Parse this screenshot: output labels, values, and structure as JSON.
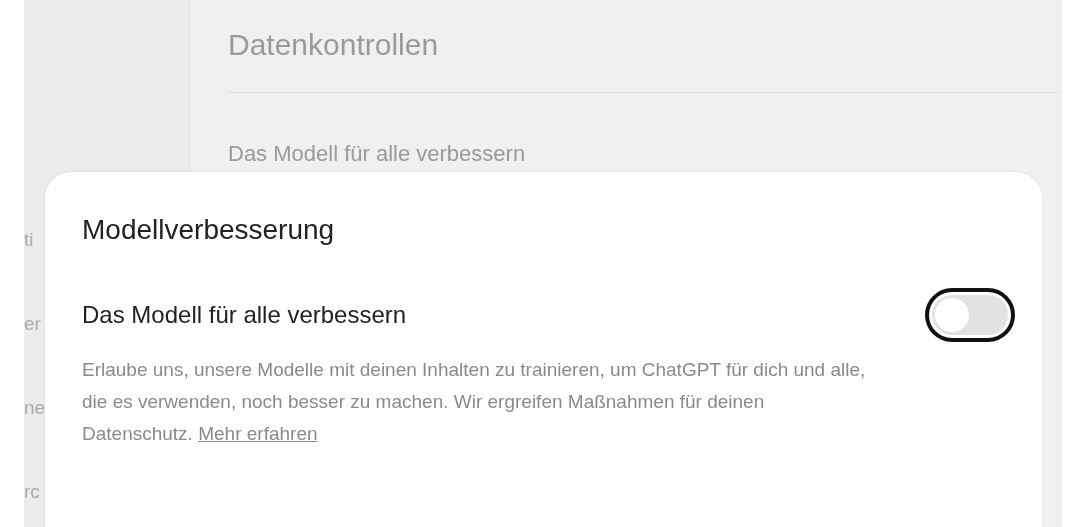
{
  "sidebar": {
    "items": [
      {
        "label": "ti"
      },
      {
        "label": "er"
      },
      {
        "label": "ne"
      },
      {
        "label": "rc"
      }
    ]
  },
  "page": {
    "title": "Datenkontrollen",
    "setting_label": "Das Modell für alle verbessern"
  },
  "dialog": {
    "title": "Modellverbesserung",
    "setting": {
      "label": "Das Modell für alle verbessern",
      "on": false
    },
    "description": "Erlaube uns, unsere Modelle mit deinen Inhalten zu trainieren, um ChatGPT für dich und alle, die es verwenden, noch besser zu machen. Wir ergreifen Maßnahmen für deinen Datenschutz.",
    "link": "Mehr erfahren"
  }
}
